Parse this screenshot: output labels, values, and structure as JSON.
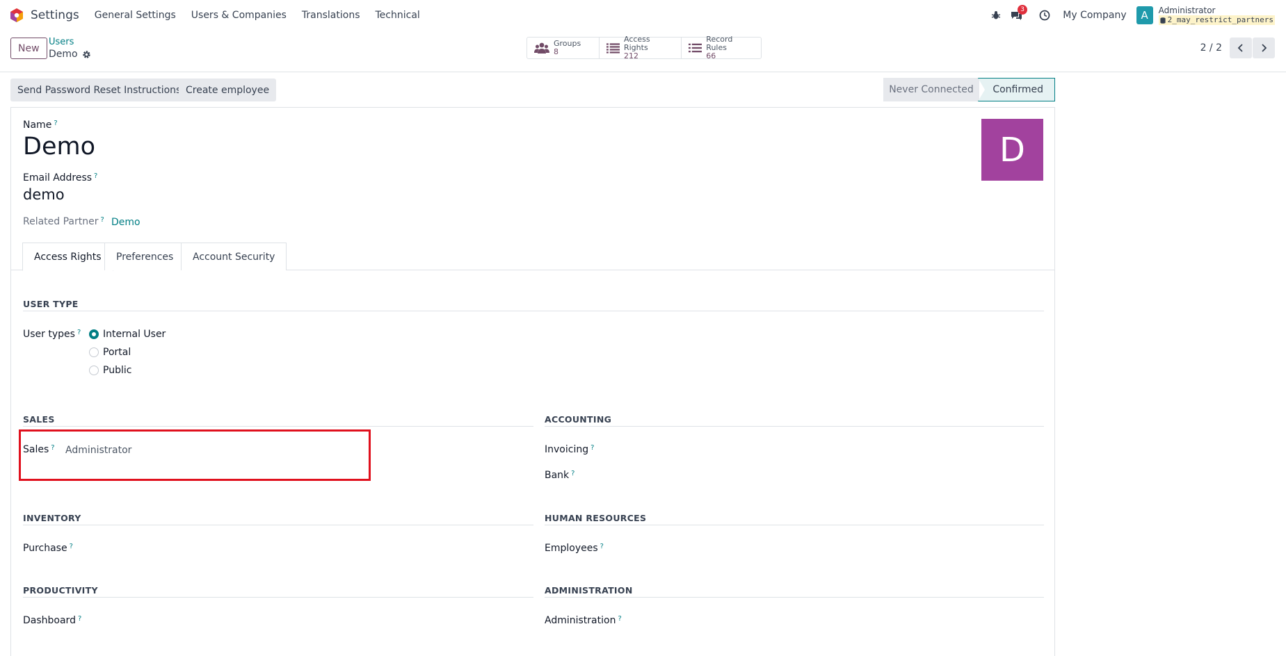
{
  "app": {
    "name": "Settings"
  },
  "menu": [
    "General Settings",
    "Users & Companies",
    "Translations",
    "Technical"
  ],
  "nav_right": {
    "notification_count": "3",
    "company": "My Company",
    "avatar_letter": "A",
    "user_name": "Administrator",
    "db_name": "2_may_restrict_partners"
  },
  "control": {
    "new_label": "New",
    "breadcrumb_parent": "Users",
    "breadcrumb_current": "Demo",
    "stats": [
      {
        "label": "Groups",
        "value": "8",
        "icon": "users-icon"
      },
      {
        "label": "Access Rights",
        "value": "212",
        "icon": "list-icon"
      },
      {
        "label": "Record Rules",
        "value": "66",
        "icon": "list-icon"
      }
    ],
    "pager": "2 / 2"
  },
  "actions": {
    "reset_password": "Send Password Reset Instructions",
    "create_employee": "Create employee"
  },
  "status": {
    "never_connected": "Never Connected",
    "confirmed": "Confirmed"
  },
  "form": {
    "name_label": "Name",
    "name_value": "Demo",
    "email_label": "Email Address",
    "email_value": "demo",
    "partner_label": "Related Partner",
    "partner_value": "Demo",
    "avatar_letter": "D",
    "help_mark": "?"
  },
  "tabs": [
    "Access Rights",
    "Preferences",
    "Account Security"
  ],
  "access": {
    "user_type_title": "USER TYPE",
    "user_types_label": "User types",
    "user_type_options": [
      "Internal User",
      "Portal",
      "Public"
    ],
    "selected_user_type": "Internal User",
    "sales_title": "SALES",
    "sales_label": "Sales",
    "sales_value": "Administrator",
    "accounting_title": "ACCOUNTING",
    "invoicing_label": "Invoicing",
    "bank_label": "Bank",
    "inventory_title": "INVENTORY",
    "purchase_label": "Purchase",
    "hr_title": "HUMAN RESOURCES",
    "employees_label": "Employees",
    "productivity_title": "PRODUCTIVITY",
    "dashboard_label": "Dashboard",
    "administration_title": "ADMINISTRATION",
    "administration_label": "Administration"
  },
  "colors": {
    "brand": "#714b67",
    "accent": "#017e84",
    "highlight": "#e0101d",
    "avatar": "#a2429e"
  }
}
